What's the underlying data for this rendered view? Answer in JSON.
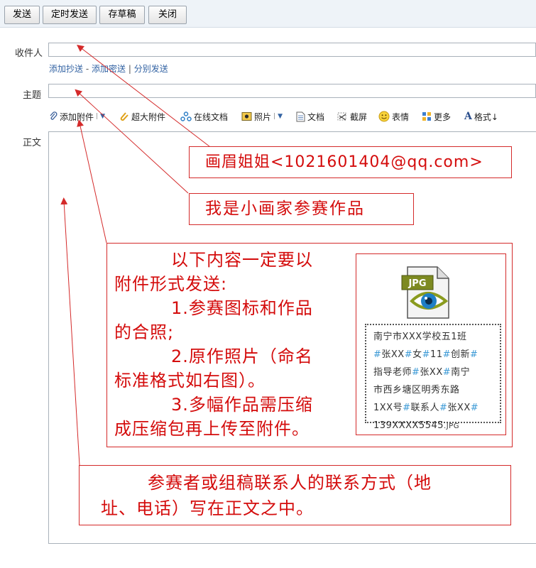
{
  "toolbar": {
    "send": "发送",
    "schedule_send": "定时发送",
    "save_draft": "存草稿",
    "close": "关闭"
  },
  "compose": {
    "recipient_label": "收件人",
    "recipient_value": "",
    "add_cc": "添加抄送",
    "dash": "-",
    "add_bcc": "添加密送",
    "pipe": "|",
    "separate_send": "分别发送",
    "subject_label": "主题",
    "subject_value": "",
    "body_label": "正文"
  },
  "attach_toolbar": {
    "add_attachment": "添加附件",
    "super_attachment": "超大附件",
    "online_doc": "在线文档",
    "photo": "照片",
    "document": "文档",
    "screenshot": "截屏",
    "emoji": "表情",
    "more": "更多",
    "format": "格式↓"
  },
  "annotations": {
    "recipient_note": "画眉姐姐<1021601404@qq.com>",
    "subject_note": "我是小画家参赛作品",
    "attachment_note": [
      "以下内容一定要以",
      "附件形式发送:",
      "1.参赛图标和作品",
      "的合照;",
      "2.原作照片（命名",
      "标准格式如右图）。",
      "3.多幅作品需压缩",
      "成压缩包再上传至附件。"
    ],
    "jpg_icon_label": "JPG",
    "filename_example": {
      "l1": "南宁市XXX学校五1班",
      "l2a": "#",
      "l2b": "张XX",
      "l2c": "#",
      "l2d": "女",
      "l2e": "#",
      "l2f": "11",
      "l2g": "#",
      "l2h": "创新",
      "l2i": "#",
      "l3a": "指导老师",
      "l3b": "#",
      "l3c": "张XX",
      "l3d": "#",
      "l3e": "南宁",
      "l4": "市西乡塘区明秀东路",
      "l5a": "1XX号",
      "l5b": "#",
      "l5c": "联系人",
      "l5d": "#",
      "l5e": "张XX",
      "l5f": "#",
      "l6a": "139XXXX5545",
      "l6b": ".JPG"
    },
    "body_note": [
      "参赛者或组稿联系人的联系方式（地",
      "址、电话）写在正文之中。"
    ]
  },
  "colors": {
    "annotation_red": "#d40c0c",
    "link_blue": "#3363a3",
    "hash_blue": "#3c9ad6"
  }
}
